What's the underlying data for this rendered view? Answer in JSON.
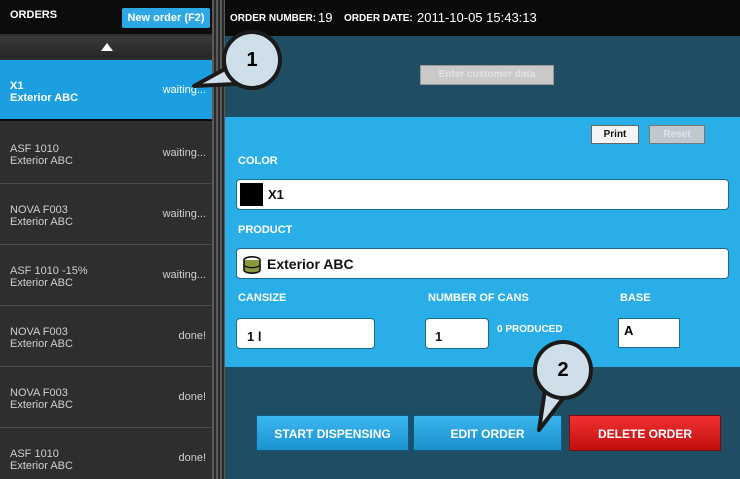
{
  "sidebar": {
    "title": "ORDERS",
    "new_order_label": "New order (F2)",
    "orders": [
      {
        "code": "X1",
        "product": "Exterior ABC",
        "status": "waiting...",
        "selected": true
      },
      {
        "code": "ASF 1010",
        "product": "Exterior ABC",
        "status": "waiting..."
      },
      {
        "code": "NOVA F003",
        "product": "Exterior ABC",
        "status": "waiting..."
      },
      {
        "code": "ASF 1010 -15%",
        "product": "Exterior ABC",
        "status": "waiting..."
      },
      {
        "code": "NOVA F003",
        "product": "Exterior ABC",
        "status": "done!"
      },
      {
        "code": "NOVA F003",
        "product": "Exterior ABC",
        "status": "done!"
      },
      {
        "code": "ASF 1010",
        "product": "Exterior ABC",
        "status": "done!"
      }
    ]
  },
  "header": {
    "order_number_label": "ORDER NUMBER:",
    "order_number": "19",
    "order_date_label": "ORDER DATE:",
    "order_date": "2011-10-05 15:43:13"
  },
  "customer": {
    "button_label": "Enter customer data"
  },
  "form": {
    "print_label": "Print",
    "reset_label": "Reset",
    "color_label": "COLOR",
    "color_value": "X1",
    "color_swatch": "#000000",
    "product_label": "PRODUCT",
    "product_value": "Exterior ABC",
    "product_icon": "paint-can-icon",
    "cansize_label": "CANSIZE",
    "cansize_value": "1 l",
    "num_cans_label": "NUMBER OF CANS",
    "num_cans_value": "1",
    "produced_text": "0 PRODUCED",
    "base_label": "BASE",
    "base_value": "A"
  },
  "actions": {
    "start_label": "START DISPENSING",
    "edit_label": "EDIT ORDER",
    "delete_label": "DELETE ORDER"
  },
  "callouts": [
    "1",
    "2"
  ]
}
